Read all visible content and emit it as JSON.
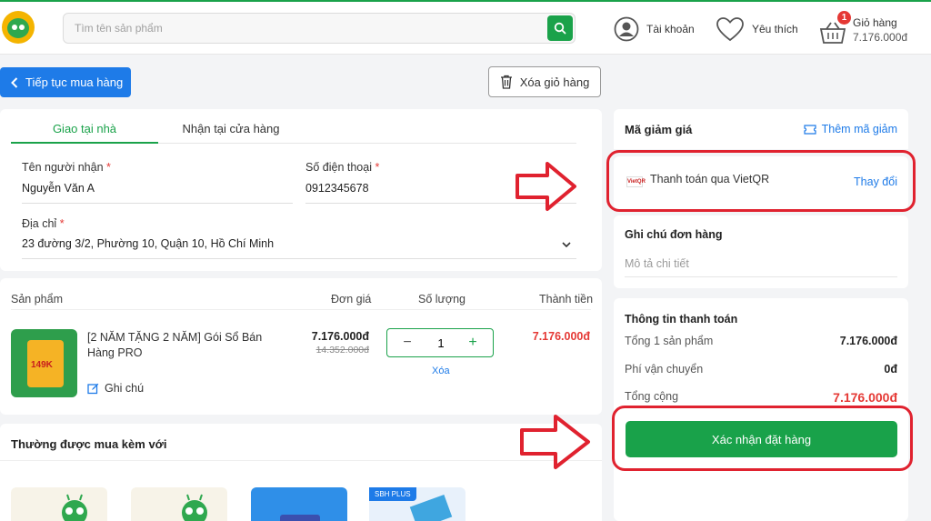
{
  "header": {
    "search_placeholder": "Tìm tên sản phẩm",
    "account_label": "Tài khoản",
    "wishlist_label": "Yêu thích",
    "cart_label": "Giỏ hàng",
    "cart_count": "1",
    "cart_total": "7.176.000đ"
  },
  "actions": {
    "continue_label": "Tiếp tục mua hàng",
    "clear_cart_label": "Xóa giỏ hàng"
  },
  "delivery": {
    "tabs": [
      "Giao tại nhà",
      "Nhận tại cửa hàng"
    ],
    "recipient_label": "Tên người nhận",
    "recipient_value": "Nguyễn Văn A",
    "phone_label": "Số điện thoại",
    "phone_value": "0912345678",
    "address_label": "Địa chỉ",
    "address_value": "23 đường 3/2, Phường 10, Quận 10, Hồ Chí Minh",
    "required_mark": "*"
  },
  "cart_table": {
    "headers": [
      "Sản phẩm",
      "Đơn giá",
      "Số lượng",
      "Thành tiền"
    ],
    "item": {
      "name": "[2 NĂM TẶNG 2 NĂM] Gói Sổ Bán Hàng PRO",
      "thumb_price": "149K",
      "price": "7.176.000đ",
      "original_price": "14.352.000đ",
      "quantity": "1",
      "remove_label": "Xóa",
      "note_label": "Ghi chú",
      "subtotal": "7.176.000đ"
    }
  },
  "related": {
    "title": "Thường được mua kèm với",
    "badge": "SBH PLUS"
  },
  "voucher": {
    "label": "Mã giảm giá",
    "add_label": "Thêm mã giảm"
  },
  "payment": {
    "logo_text": "VietQR",
    "method_label": "Thanh toán qua VietQR",
    "change_label": "Thay đổi"
  },
  "order_note": {
    "label": "Ghi chú đơn hàng",
    "placeholder": "Mô tả chi tiết"
  },
  "summary": {
    "title": "Thông tin thanh toán",
    "subtotal_label": "Tổng 1 sản phẩm",
    "subtotal_value": "7.176.000đ",
    "shipping_label": "Phí vận chuyển",
    "shipping_value": "0đ",
    "total_label": "Tổng cộng",
    "total_value": "7.176.000đ",
    "confirm_label": "Xác nhận đặt hàng"
  },
  "colors": {
    "brand_green": "#1aa24a",
    "link_blue": "#1e7be8",
    "price_red": "#e53935",
    "highlight_red": "#e0222f"
  }
}
